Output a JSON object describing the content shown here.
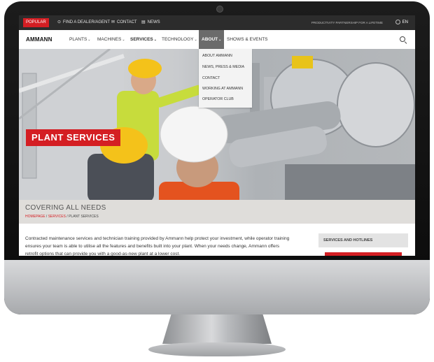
{
  "topbar": {
    "popular": "POPULAR",
    "find_dealer": "FIND A DEALER/AGENT",
    "contact": "CONTACT",
    "news": "NEWS",
    "tagline": "PRODUCTIVITY PARTNERSHIP FOR A LIFETIME",
    "language": "EN"
  },
  "nav": {
    "logo": "AMMANN",
    "items": [
      "PLANTS",
      "MACHINES",
      "SERVICES",
      "TECHNOLOGY",
      "ABOUT",
      "SHOWS & EVENTS"
    ]
  },
  "dropdown": {
    "items": [
      "ABOUT AMMANN",
      "NEWS, PRESS & MEDIA",
      "CONTACT",
      "WORKING AT AMMANN",
      "OPERATOR CLUB"
    ]
  },
  "hero": {
    "title": "PLANT SERVICES"
  },
  "section": {
    "title": "COVERING ALL NEEDS",
    "breadcrumb": [
      "HOMEPAGE",
      "SERVICES",
      "PLANT SERVICES"
    ]
  },
  "body": {
    "paragraph": "Contracted maintenance services and technician training provided by Ammann help protect your investment, while operator training ensures your team is able to utilise all the features and benefits built into your plant. When your needs change, Ammann offers retrofit options that can provide you with a good-as-new plant at a lower cost."
  },
  "sidebar": {
    "title": "SERVICES AND HOTLINES"
  },
  "colors": {
    "accent": "#d41e23",
    "topbar": "#2c2c2c",
    "section_bg": "#dfddda"
  }
}
